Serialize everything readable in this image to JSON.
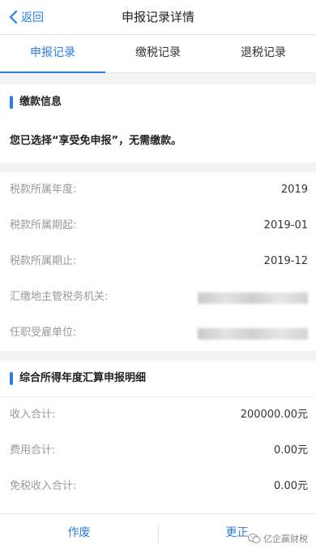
{
  "nav": {
    "back_label": "返回",
    "title": "申报记录详情"
  },
  "tabs": [
    {
      "label": "申报记录",
      "active": true
    },
    {
      "label": "缴税记录",
      "active": false
    },
    {
      "label": "退税记录",
      "active": false
    }
  ],
  "payment_section": {
    "title": "缴款信息",
    "notice": "您已选择“享受免申报”，无需缴款。"
  },
  "tax_info": {
    "rows": [
      {
        "label": "税款所属年度:",
        "value": "2019"
      },
      {
        "label": "税款所属期起:",
        "value": "2019-01"
      },
      {
        "label": "税款所属期止:",
        "value": "2019-12"
      },
      {
        "label": "汇缴地主管税务机关:",
        "value": ""
      },
      {
        "label": "任职受雇单位:",
        "value": ""
      }
    ]
  },
  "detail_section": {
    "title": "综合所得年度汇算申报明细",
    "rows": [
      {
        "label": "收入合计:",
        "value": "200000.00元"
      },
      {
        "label": "费用合计:",
        "value": "0.00元"
      },
      {
        "label": "免税收入合计:",
        "value": "0.00元"
      }
    ]
  },
  "bottom_actions": {
    "void_label": "作废",
    "correct_label": "更正"
  },
  "watermark": {
    "text": "亿企赢财税"
  },
  "colors": {
    "accent": "#2b7de9",
    "background": "#f2f3f5"
  }
}
